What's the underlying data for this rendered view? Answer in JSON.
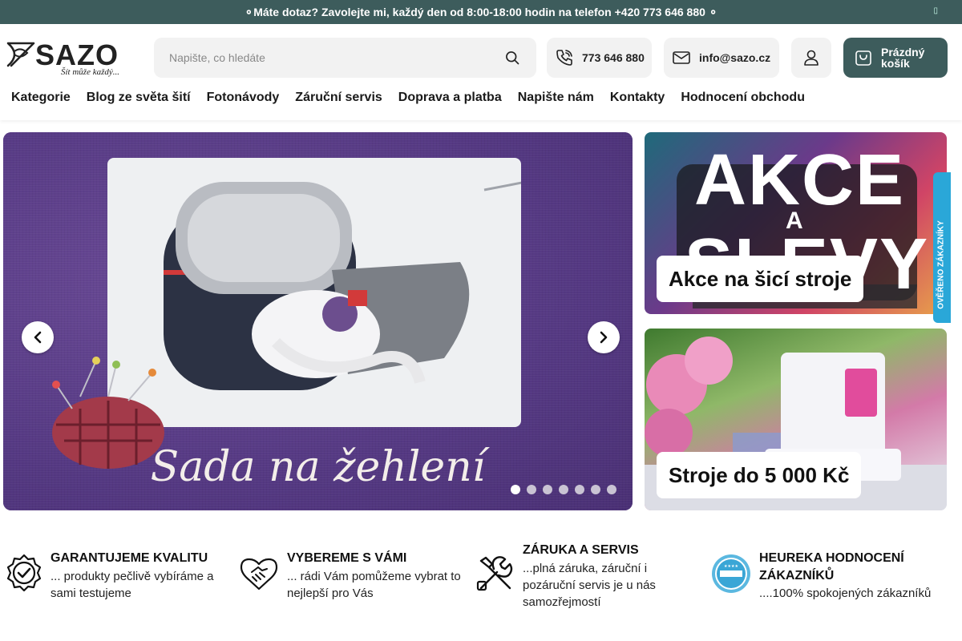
{
  "topbar": {
    "message": "⚬Máte dotaz? Zavolejte mi, každý den od 8:00-18:00 hodin na telefon +420 773 646 880 ⚬",
    "close_symbol": "▯"
  },
  "header": {
    "logo": {
      "brand": "SAZO",
      "tagline": "Šít může každý..."
    },
    "search": {
      "placeholder": "Napište, co hledáte",
      "value": ""
    },
    "phone": {
      "label": "773 646 880",
      "icon": "phone-icon"
    },
    "email": {
      "label": "info@sazo.cz",
      "icon": "mail-icon"
    },
    "account": {
      "icon": "user-icon"
    },
    "cart": {
      "label": "Prázdný košík",
      "icon": "cart-icon"
    }
  },
  "nav": {
    "items": [
      {
        "label": "Kategorie"
      },
      {
        "label": "Blog ze světa šití"
      },
      {
        "label": "Fotonávody"
      },
      {
        "label": "Záruční servis"
      },
      {
        "label": "Doprava a platba"
      },
      {
        "label": "Napište nám"
      },
      {
        "label": "Kontakty"
      },
      {
        "label": "Hodnocení obchodu"
      }
    ]
  },
  "hero": {
    "slide_text": "Sada na žehlení",
    "slide_count": 7,
    "active_slide": 1
  },
  "promos": [
    {
      "label": "Akce na šicí stroje",
      "art_big": "AKCE",
      "art_mid": "A",
      "art_big2": "SLEVY"
    },
    {
      "label": "Stroje do 5 000 Kč"
    }
  ],
  "badge": {
    "text": "OVĚŘENO ZÁKAZNÍKY"
  },
  "features": [
    {
      "title": "GARANTUJEME KVALITU",
      "text": "... produkty pečlivě vybíráme a sami testujeme",
      "icon": "quality-badge-icon"
    },
    {
      "title": "VYBEREME S VÁMI",
      "text": "... rádi Vám pomůžeme vybrat to nejlepší pro Vás",
      "icon": "handshake-icon"
    },
    {
      "title": "ZÁRUKA A SERVIS",
      "text": "...plná záruka, záruční i pozáruční servis je u nás samozřejmostí",
      "icon": "tools-icon"
    },
    {
      "title": "HEUREKA HODNOCENÍ ZÁKAZNÍKŮ",
      "text": "....100% spokojených zákazníků",
      "icon": "heureka-icon"
    }
  ]
}
